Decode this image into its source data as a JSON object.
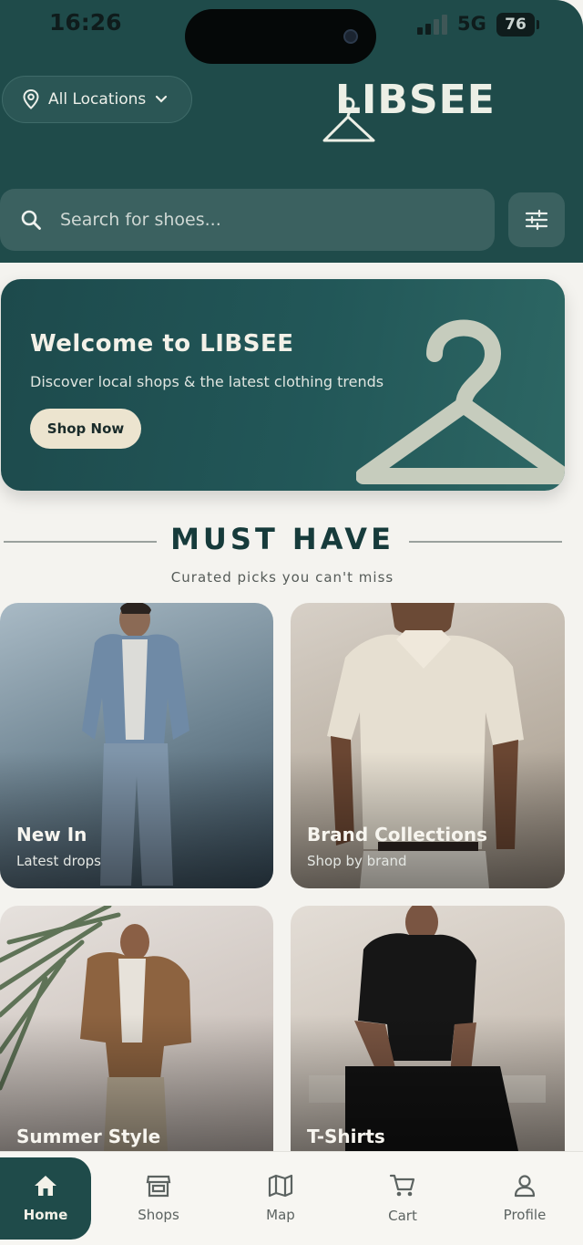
{
  "status_bar": {
    "time": "16:26",
    "network": "5G",
    "battery": "76"
  },
  "header": {
    "location_label": "All Locations",
    "logo_text": "LIBSEE",
    "search": {
      "placeholder": "Search for shoes..."
    }
  },
  "banner": {
    "title": "Welcome to LIBSEE",
    "subtitle": "Discover local shops & the latest clothing trends",
    "button_label": "Shop Now"
  },
  "section": {
    "title": "MUST HAVE",
    "subtitle": "Curated picks you can't miss"
  },
  "cards": [
    {
      "title": "New In",
      "subtitle": "Latest drops"
    },
    {
      "title": "Brand Collections",
      "subtitle": "Shop by brand"
    },
    {
      "title": "Summer Style",
      "subtitle": ""
    },
    {
      "title": "T-Shirts",
      "subtitle": ""
    }
  ],
  "bottom_nav": [
    {
      "label": "Home",
      "icon": "home-icon",
      "active": true
    },
    {
      "label": "Shops",
      "icon": "store-icon",
      "active": false
    },
    {
      "label": "Map",
      "icon": "map-icon",
      "active": false
    },
    {
      "label": "Cart",
      "icon": "cart-icon",
      "active": false
    },
    {
      "label": "Profile",
      "icon": "profile-icon",
      "active": false
    }
  ],
  "colors": {
    "primary": "#1f4b4a",
    "accent_cream": "#ece4cf",
    "background": "#f4f3ef"
  }
}
